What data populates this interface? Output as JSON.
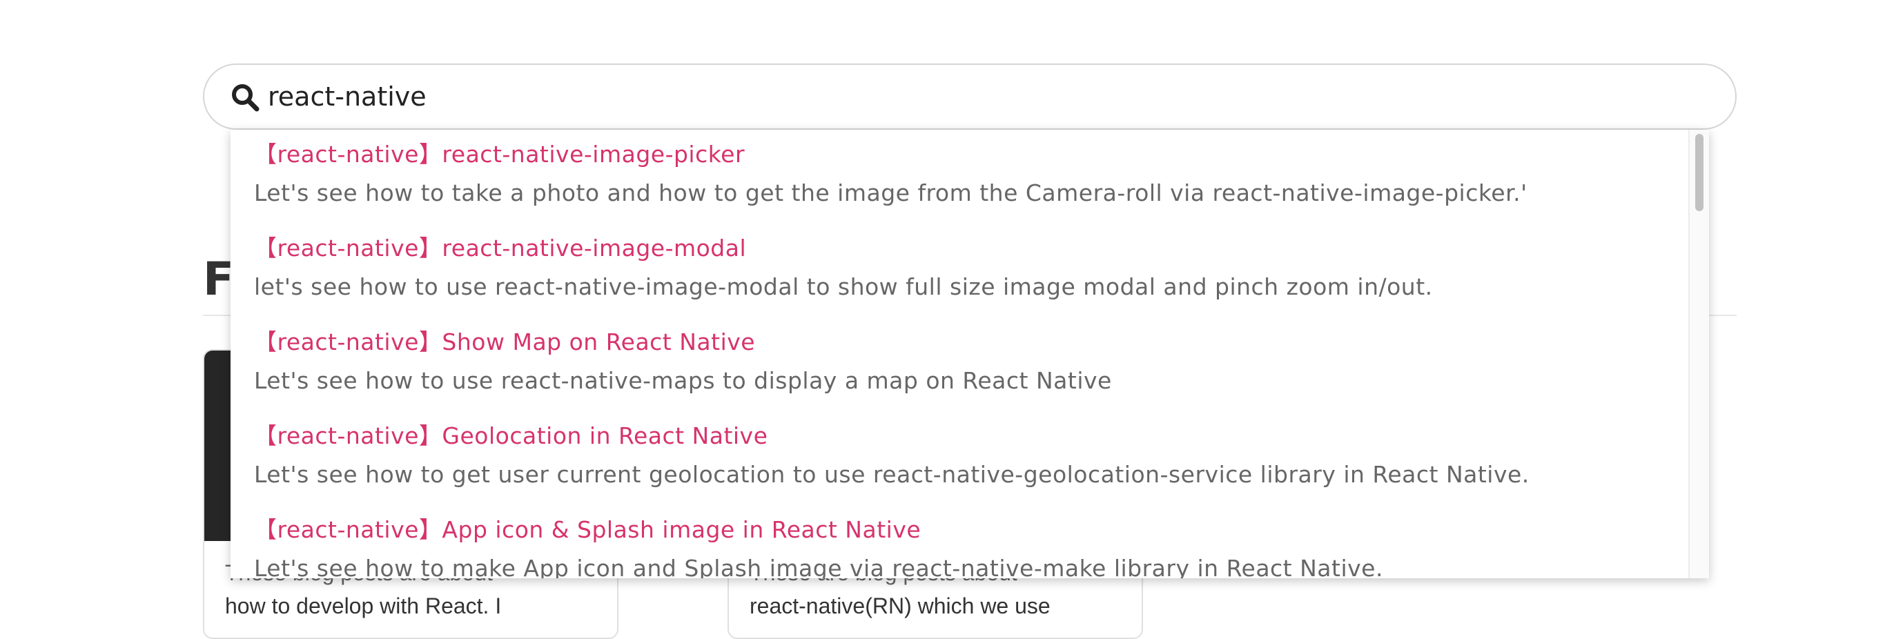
{
  "search": {
    "value": "react-native",
    "placeholder": ""
  },
  "background": {
    "heading_partial": "Fr",
    "cards": [
      {
        "line1": "These blog posts are about",
        "line2": "how to develop with React. I"
      },
      {
        "line1": "These are blog posts about",
        "line2": "react-native(RN) which we use"
      }
    ]
  },
  "results": [
    {
      "title": "【react-native】react-native-image-picker",
      "description": "Let's see how to take a photo and how to get the image from the Camera-roll via react-native-image-picker.'"
    },
    {
      "title": "【react-native】react-native-image-modal",
      "description": "let's see how to use react-native-image-modal to show full size image modal and pinch zoom in/out."
    },
    {
      "title": "【react-native】Show Map on React Native",
      "description": "Let's see how to use react-native-maps to display a map on React Native"
    },
    {
      "title": "【react-native】Geolocation in React Native",
      "description": "Let's see how to get user current geolocation to use react-native-geolocation-service library in React Native."
    },
    {
      "title": "【react-native】App icon & Splash image in React Native",
      "description": "Let's see how to make App icon and Splash image via react-native-make library in React Native."
    }
  ],
  "colors": {
    "result_title": "#d6336c",
    "result_description": "#666666",
    "search_border": "#d6d6d6"
  },
  "icons": {
    "search": "search-icon"
  }
}
